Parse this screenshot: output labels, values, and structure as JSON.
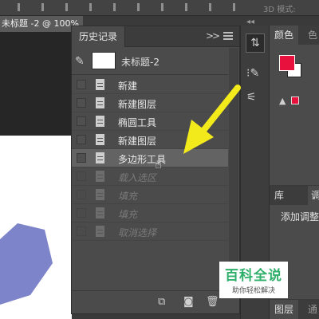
{
  "topbar": {
    "mode_label": "3D 模式:"
  },
  "document": {
    "tab_title": "未标题 -2 @ 100%"
  },
  "history_panel": {
    "title": "历史记录",
    "collapse_glyph": ">>",
    "snapshot_name": "未标题-2",
    "items": [
      {
        "label": "新建",
        "state": "normal"
      },
      {
        "label": "新建图层",
        "state": "normal"
      },
      {
        "label": "椭圆工具",
        "state": "normal"
      },
      {
        "label": "新建图层",
        "state": "normal"
      },
      {
        "label": "多边形工具",
        "state": "active"
      },
      {
        "label": "载入选区",
        "state": "dim"
      },
      {
        "label": "填充",
        "state": "dim"
      },
      {
        "label": "填充",
        "state": "dim"
      },
      {
        "label": "取消选择",
        "state": "dim"
      }
    ]
  },
  "right_panel": {
    "color_tab": "颜色",
    "color_tab2": "色",
    "lib_tab": "库",
    "adjust_tab": "调",
    "adjust_label": "添加调整",
    "layers_tab": "图层",
    "channels_tab": "通",
    "foreground_color": "#e8103c",
    "background_color": "#ffffff"
  },
  "watermark": {
    "title": "百科全说",
    "subtitle": "助你轻松解决"
  },
  "colors": {
    "arrow": "#f2ea1a",
    "shape_fill": "#7d84c9"
  },
  "icons": {
    "snapshot_brush": "history-brush-icon",
    "doc": "document-state-icon",
    "new_document": "new-document-from-state-icon",
    "snapshot": "camera-icon",
    "delete": "trash-icon"
  }
}
